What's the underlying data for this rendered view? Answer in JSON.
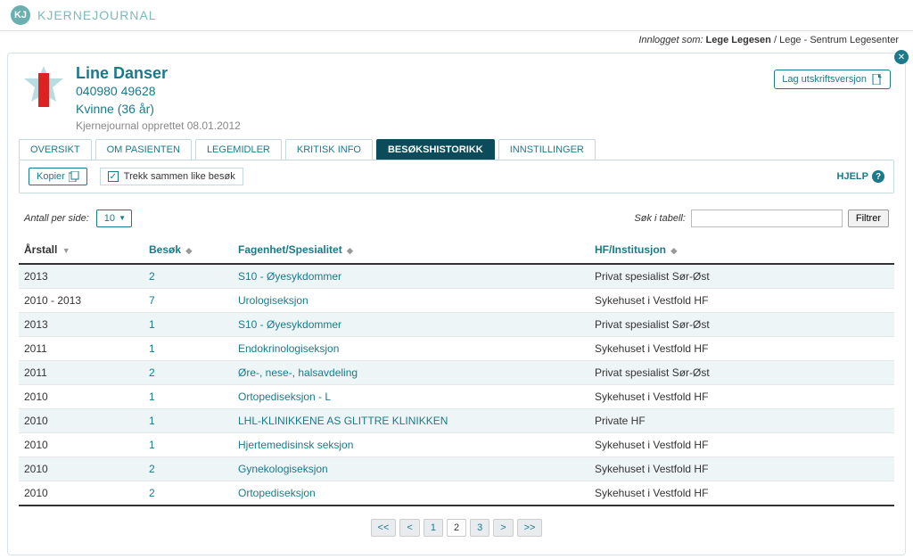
{
  "brand": {
    "initials": "KJ",
    "name": "KJERNEJOURNAL"
  },
  "login": {
    "label": "Innlogget som:",
    "user": "Lege Legesen",
    "sep": "/",
    "role": "Lege - Sentrum Legesenter"
  },
  "patient": {
    "name": "Line Danser",
    "id": "040980 49628",
    "demographics": "Kvinne (36 år)",
    "created": "Kjernejournal opprettet 08.01.2012"
  },
  "buttons": {
    "print": "Lag utskriftsversjon",
    "copy": "Kopier",
    "help": "HJELP",
    "filter": "Filtrer"
  },
  "tabs": [
    "OVERSIKT",
    "OM PASIENTEN",
    "LEGEMIDLER",
    "KRITISK INFO",
    "BESØKSHISTORIKK",
    "INNSTILLINGER"
  ],
  "active_tab": 4,
  "toolbar": {
    "checkbox_label": "Trekk sammen like besøk",
    "checked": true
  },
  "controls": {
    "per_page_label": "Antall per side:",
    "per_page_value": "10",
    "search_label": "Søk i tabell:",
    "search_value": ""
  },
  "columns": {
    "year": "Årstall",
    "visits": "Besøk",
    "unit": "Fagenhet/Spesialitet",
    "inst": "HF/Institusjon"
  },
  "rows": [
    {
      "year": "2013",
      "visits": "2",
      "unit": "S10 - Øyesykdommer",
      "inst": "Privat spesialist Sør-Øst"
    },
    {
      "year": "2010 - 2013",
      "visits": "7",
      "unit": "Urologiseksjon",
      "inst": "Sykehuset i Vestfold HF"
    },
    {
      "year": "2013",
      "visits": "1",
      "unit": "S10 - Øyesykdommer",
      "inst": "Privat spesialist Sør-Øst"
    },
    {
      "year": "2011",
      "visits": "1",
      "unit": "Endokrinologiseksjon",
      "inst": "Sykehuset i Vestfold HF"
    },
    {
      "year": "2011",
      "visits": "2",
      "unit": "Øre-, nese-, halsavdeling",
      "inst": "Privat spesialist Sør-Øst"
    },
    {
      "year": "2010",
      "visits": "1",
      "unit": "Ortopediseksjon - L",
      "inst": "Sykehuset i Vestfold HF"
    },
    {
      "year": "2010",
      "visits": "1",
      "unit": "LHL-KLINIKKENE AS GLITTRE KLINIKKEN",
      "inst": "Private HF"
    },
    {
      "year": "2010",
      "visits": "1",
      "unit": "Hjertemedisinsk seksjon",
      "inst": "Sykehuset i Vestfold HF"
    },
    {
      "year": "2010",
      "visits": "2",
      "unit": "Gynekologiseksjon",
      "inst": "Sykehuset i Vestfold HF"
    },
    {
      "year": "2010",
      "visits": "2",
      "unit": "Ortopediseksjon",
      "inst": "Sykehuset i Vestfold HF"
    }
  ],
  "pager": {
    "first": "<<",
    "prev": "<",
    "pages": [
      "1",
      "2",
      "3"
    ],
    "current": "2",
    "next": ">",
    "last": ">>"
  }
}
